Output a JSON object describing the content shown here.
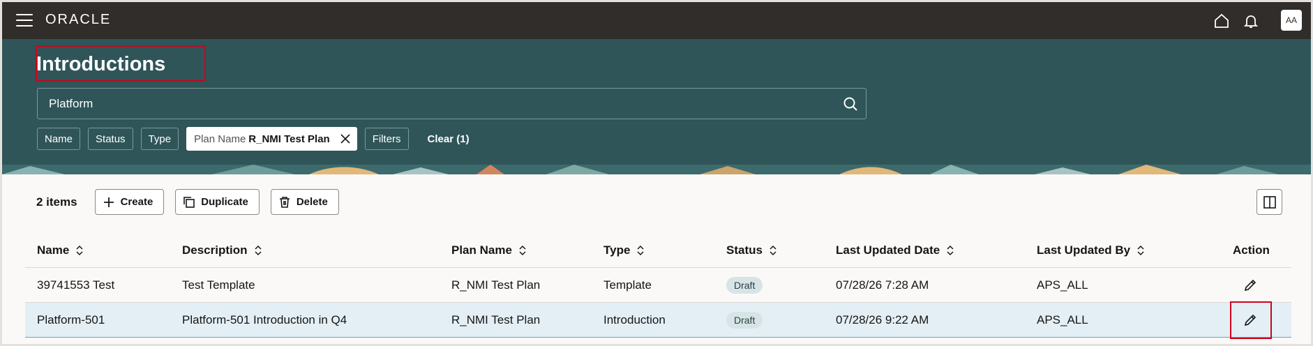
{
  "topbar": {
    "logo": "ORACLE",
    "avatar_initials": "AA",
    "icons": [
      "menu-icon",
      "home-icon",
      "bell-icon"
    ]
  },
  "header": {
    "title": "Introductions",
    "search_value": "Platform",
    "filters": {
      "name": "Name",
      "status": "Status",
      "type": "Type",
      "active_key": "Plan Name",
      "active_value": "R_NMI Test Plan",
      "filters_label": "Filters",
      "clear_label": "Clear (1)"
    }
  },
  "toolbar": {
    "count": "2 items",
    "create": "Create",
    "duplicate": "Duplicate",
    "delete": "Delete"
  },
  "table": {
    "columns": [
      "Name",
      "Description",
      "Plan Name",
      "Type",
      "Status",
      "Last Updated Date",
      "Last Updated By",
      "Action"
    ],
    "rows": [
      {
        "name": "39741553 Test",
        "description": "Test Template",
        "plan": "R_NMI Test Plan",
        "type": "Template",
        "status": "Draft",
        "date": "07/28/26 7:28 AM",
        "by": "APS_ALL"
      },
      {
        "name": "Platform-501",
        "description": "Platform-501 Introduction in Q4",
        "plan": "R_NMI Test Plan",
        "type": "Introduction",
        "status": "Draft",
        "date": "07/28/26 9:22 AM",
        "by": "APS_ALL"
      }
    ]
  },
  "colors": {
    "topbar": "#312d2a",
    "header": "#2f5559",
    "highlight": "#d0021b",
    "selected_row": "#e4eff5"
  }
}
